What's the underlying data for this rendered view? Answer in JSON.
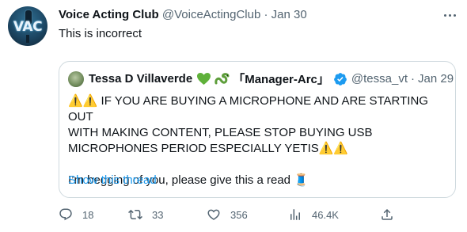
{
  "tweet": {
    "author_name": "Voice Acting Club",
    "author_handle": "@VoiceActingClub",
    "separator": "·",
    "date": "Jan 30",
    "avatar_text": "VAC",
    "text": "This is incorrect"
  },
  "quoted_tweet": {
    "author_name": "Tessa D Villaverde",
    "name_suffix": "「Manager-Arc」",
    "author_handle": "@tessa_vt",
    "separator": "·",
    "date": "Jan 29",
    "verified": true,
    "line1": "⚠️⚠️ IF YOU ARE BUYING A MICROPHONE AND ARE STARTING OUT",
    "line2": "WITH MAKING CONTENT, PLEASE STOP BUYING USB",
    "line3": "MICROPHONES PERIOD ESPECIALLY YETIS⚠️⚠️",
    "line4": "I’m begging of you, please give this a read 🧵",
    "show_thread": "Show this thread"
  },
  "actions": {
    "replies": "18",
    "retweets": "33",
    "likes": "356",
    "views": "46.4K"
  },
  "colors": {
    "text": "#0f1419",
    "muted": "#536471",
    "link": "#1d9bf0",
    "border": "#cfd9de",
    "green_heart": "#5fb13a",
    "verified": "#1d9bf0"
  },
  "icons": [
    "more-icon",
    "verified-badge-icon",
    "green-heart-icon",
    "snake-emoji-icon",
    "reply-icon",
    "retweet-icon",
    "like-icon",
    "views-icon",
    "share-icon"
  ]
}
